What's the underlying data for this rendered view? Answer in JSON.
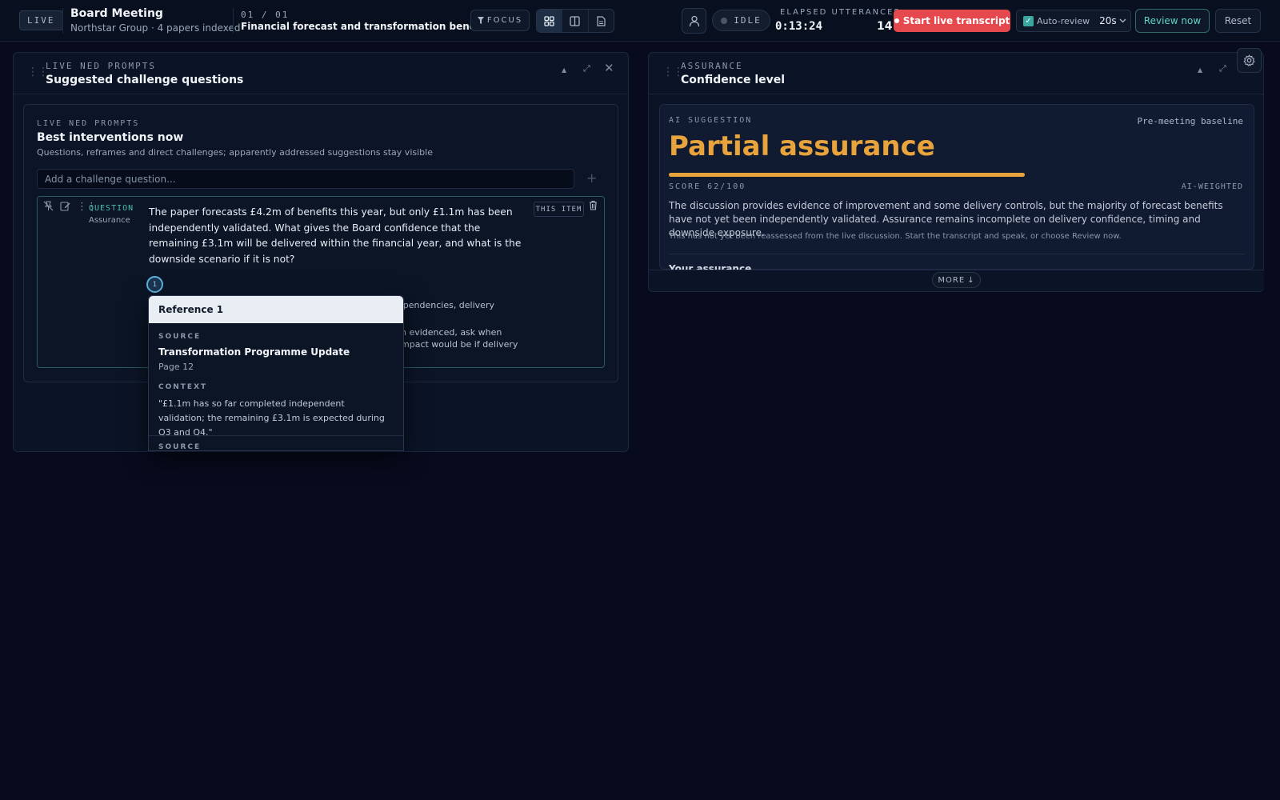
{
  "header": {
    "live_label": "LIVE",
    "title": "Board Meeting",
    "subtitle": "Northstar Group · 4 papers indexed",
    "pager": "01 / 01",
    "agenda_item": "Financial forecast and transformation benefits",
    "focus_label": "FOCUS",
    "status_label": "IDLE",
    "elapsed_label": "ELAPSED",
    "elapsed_value": "0:13:24",
    "utterances_label": "UTTERANCES",
    "utterances_value": "14",
    "start_transcript_label": "Start live transcript",
    "auto_review_label": "Auto-review",
    "auto_review_checked": true,
    "auto_review_interval": "20s",
    "review_now_label": "Review now",
    "reset_label": "Reset"
  },
  "left_panel": {
    "eyebrow": "LIVE NED PROMPTS",
    "title": "Suggested challenge questions",
    "inner": {
      "kicker": "LIVE NED PROMPTS",
      "heading": "Best interventions now",
      "description": "Questions, reframes and direct challenges; apparently addressed suggestions stay visible",
      "input_placeholder": "Add a challenge question..."
    },
    "question": {
      "type_label": "QUESTION",
      "category": "Assurance",
      "text": "The paper forecasts £4.2m of benefits this year, but only £1.1m has been independently validated. What gives the Board confidence that the remaining £3.1m will be delivered within the financial year, and what is the downside scenario if it is not?",
      "this_item_label": "THIS ITEM",
      "reference_number": "1",
      "partial_line_1": "ependencies, delivery",
      "partial_line_2": "n evidenced, ask when",
      "partial_line_3": "mpact would be if delivery"
    },
    "reference_popover": {
      "title": "Reference 1",
      "source_label": "SOURCE",
      "source": "Transformation Programme Update",
      "page": "Page 12",
      "context_label": "CONTEXT",
      "context": "\"£1.1m has so far completed independent validation; the remaining £3.1m is expected during Q3 and Q4.\"",
      "next_source_label": "SOURCE"
    }
  },
  "right_panel": {
    "eyebrow": "ASSURANCE",
    "title": "Confidence level",
    "ai_label": "AI SUGGESTION",
    "baseline_label": "Pre-meeting baseline",
    "assessment": "Partial assurance",
    "score_text": "SCORE 62/100",
    "score_value": 62,
    "weighted_label": "AI-WEIGHTED",
    "description": "The discussion provides evidence of improvement and some delivery controls, but the majority of forecast benefits have not yet been independently validated. Assurance remains incomplete on delivery confidence, timing and downside exposure.",
    "note": "This has not yet been reassessed from the live discussion. Start the transcript and speak, or choose Review now.",
    "your_assurance_label": "Your assurance",
    "more_label": "MORE"
  },
  "colors": {
    "accent_teal": "#4bbeb2",
    "danger": "#e5484d",
    "partial_amber": "#e8a33c",
    "background": "#070b1d"
  }
}
